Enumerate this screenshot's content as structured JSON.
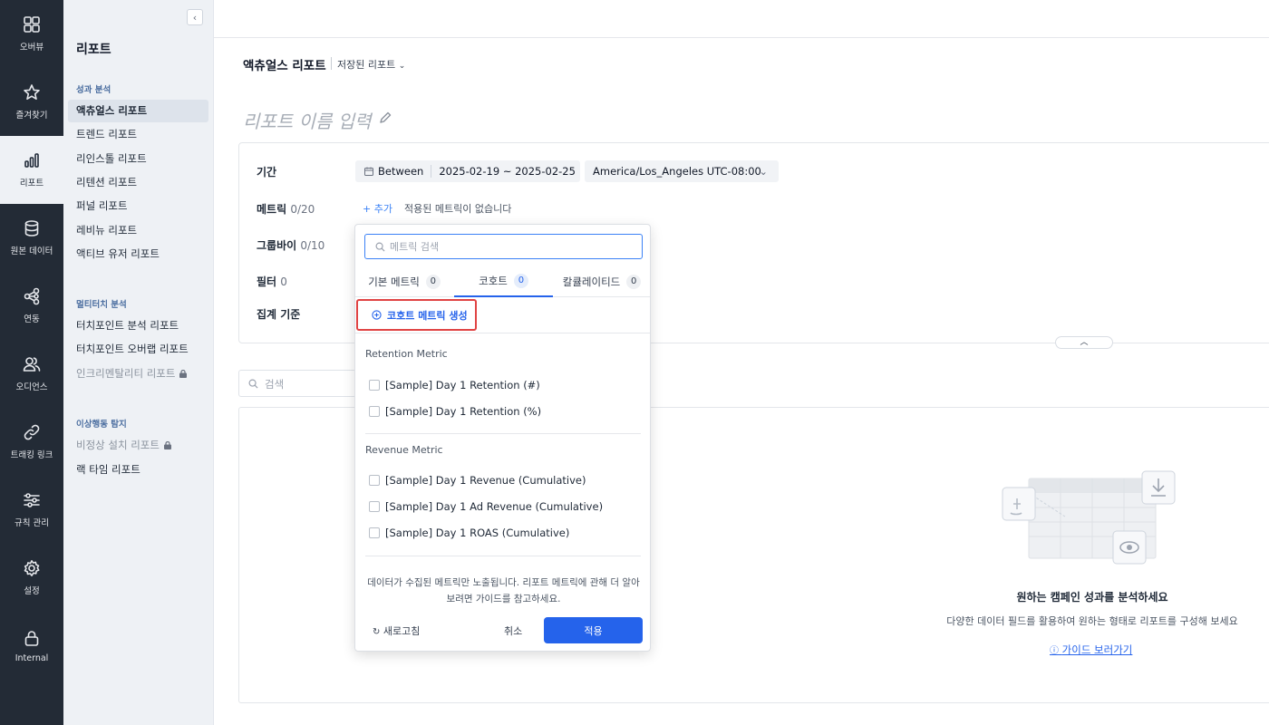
{
  "rail": [
    {
      "label": "오버뷰",
      "icon": "grid-icon"
    },
    {
      "label": "즐겨찾기",
      "icon": "star-icon"
    },
    {
      "label": "리포트",
      "icon": "bar-chart-icon"
    },
    {
      "label": "원본 데이터",
      "icon": "database-icon"
    },
    {
      "label": "연동",
      "icon": "integration-icon"
    },
    {
      "label": "오디언스",
      "icon": "users-icon"
    },
    {
      "label": "트래킹 링크",
      "icon": "link-icon"
    },
    {
      "label": "규칙 관리",
      "icon": "sliders-icon"
    },
    {
      "label": "설정",
      "icon": "gear-icon"
    },
    {
      "label": "Internal",
      "icon": "lock-icon"
    }
  ],
  "sidebar": {
    "title": "리포트",
    "sections": [
      {
        "title": "성과 분석",
        "items": [
          "액츄얼스 리포트",
          "트렌드 리포트",
          "리인스톨 리포트",
          "리텐션 리포트",
          "퍼널 리포트",
          "레비뉴 리포트",
          "액티브 유저 리포트"
        ]
      },
      {
        "title": "멀티터치 분석",
        "items": [
          "터치포인트 분석 리포트",
          "터치포인트 오버랩 리포트",
          "인크리멘탈리티 리포트"
        ]
      },
      {
        "title": "이상행동 탐지",
        "items": [
          "비정상 설치 리포트",
          "랙 타임 리포트"
        ]
      }
    ]
  },
  "header": {
    "title": "액츄얼스 리포트",
    "saved_reports": "저장된 리포트",
    "report_name_placeholder": "리포트 이름 입력"
  },
  "filters": {
    "period_label": "기간",
    "between": "Between",
    "date_range": "2025-02-19 ~ 2025-02-25",
    "timezone": "America/Los_Angeles UTC-08:00",
    "metric_label": "메트릭",
    "metric_count": "0/20",
    "add_label": "+ 추가",
    "no_metric": "적용된 메트릭이 없습니다",
    "groupby_label": "그룹바이",
    "groupby_count": "0/10",
    "filter_label": "필터",
    "filter_count": "0",
    "aggregation_label": "집계 기준"
  },
  "search": {
    "placeholder": "검색"
  },
  "empty_state": {
    "title": "원하는 캠페인 성과를 분석하세요",
    "subtitle": "다양한 데이터 필드를 활용하여 원하는 형태로 리포트를 구성해 보세요",
    "guide_link": "가이드 보러가기"
  },
  "dropdown": {
    "search_placeholder": "메트릭 검색",
    "tabs": [
      {
        "label": "기본 메트릭",
        "count": "0"
      },
      {
        "label": "코호트",
        "count": "0"
      },
      {
        "label": "칼큘레이티드",
        "count": "0"
      }
    ],
    "active_tab": "코호트",
    "create_button": "코호트 메트릭 생성",
    "groups": [
      {
        "title": "Retention Metric",
        "options": [
          "[Sample] Day 1 Retention (#)",
          "[Sample] Day 1 Retention (%)"
        ]
      },
      {
        "title": "Revenue Metric",
        "options": [
          "[Sample] Day 1 Revenue (Cumulative)",
          "[Sample] Day 1 Ad Revenue (Cumulative)",
          "[Sample] Day 1 ROAS (Cumulative)"
        ]
      }
    ],
    "help_text": "데이터가 수집된 메트릭만 노출됩니다. 리포트 메트릭에 관해 더 알아보려면 가이드를 참고하세요.",
    "refresh": "새로고침",
    "cancel": "취소",
    "apply": "적용"
  },
  "colors": {
    "rail_bg": "#232b36",
    "accent": "#2563eb",
    "highlight": "#e04343"
  }
}
